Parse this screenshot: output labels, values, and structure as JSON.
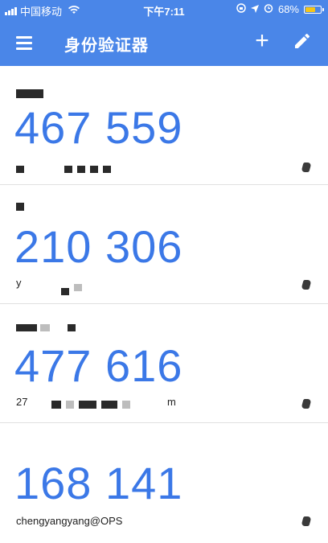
{
  "status_bar": {
    "carrier": "中国移动",
    "time": "下午7:11",
    "battery": "68%",
    "battery_fraction": 0.68
  },
  "app_bar": {
    "title": "身份验证器",
    "menu_icon": "menu-icon",
    "add_icon": "add-icon",
    "edit_icon": "edit-pencil-icon"
  },
  "accounts": [
    {
      "code": "467 559",
      "account": ""
    },
    {
      "code": "210 306",
      "account": "y"
    },
    {
      "code": "477 616",
      "account": "27",
      "account_suffix": "m"
    },
    {
      "code": "168 141",
      "account": "chengyangyang@OPS"
    }
  ],
  "colors": {
    "primary": "#4a86e8",
    "code": "#3b78e7",
    "battery": "#f5c518"
  }
}
